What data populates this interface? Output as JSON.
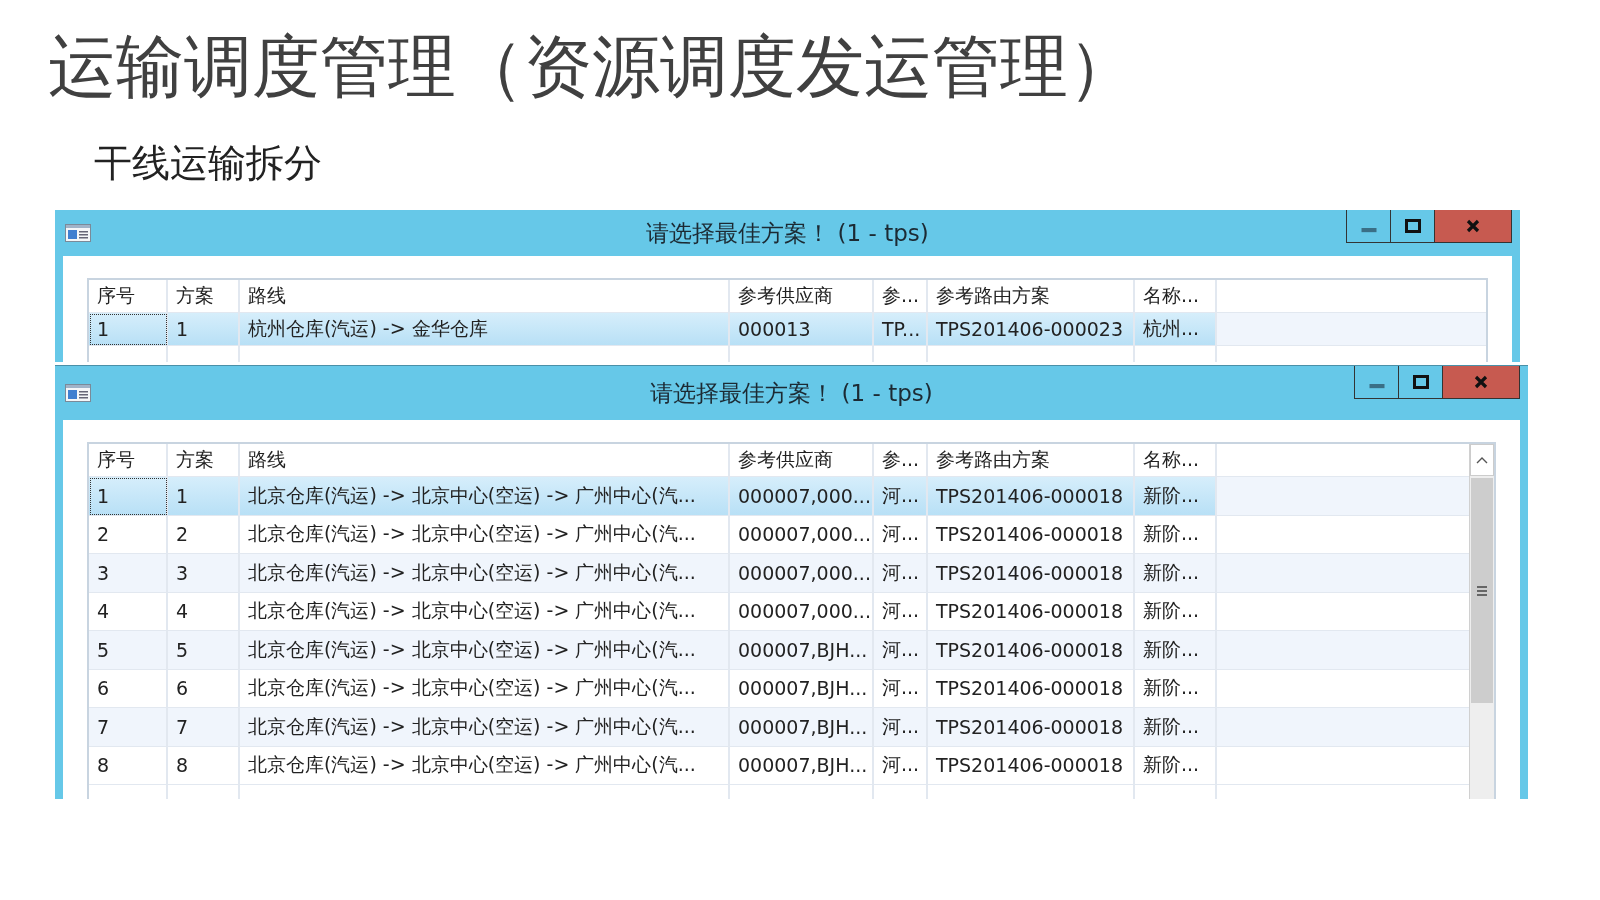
{
  "slide": {
    "title": "运输调度管理（资源调度发运管理）",
    "subtitle": "干线运输拆分"
  },
  "windows": [
    {
      "title": "请选择最佳方案！ (1 - tps)",
      "scrollbar": false,
      "columns": [
        "序号",
        "方案",
        "路线",
        "参考供应商",
        "参...",
        "参考路由方案",
        "名称..."
      ],
      "rows": [
        {
          "selected": true,
          "cells": [
            "1",
            "1",
            "杭州仓库(汽运) -> 金华仓库",
            "000013",
            "TP...",
            "TPS201406-000023",
            "杭州..."
          ]
        }
      ]
    },
    {
      "title": "请选择最佳方案！ (1 - tps)",
      "scrollbar": true,
      "columns": [
        "序号",
        "方案",
        "路线",
        "参考供应商",
        "参...",
        "参考路由方案",
        "名称..."
      ],
      "rows": [
        {
          "selected": true,
          "cells": [
            "1",
            "1",
            "北京仓库(汽运) -> 北京中心(空运) -> 广州中心(汽...",
            "000007,000...",
            "河...",
            "TPS201406-000018",
            "新阶..."
          ]
        },
        {
          "selected": false,
          "cells": [
            "2",
            "2",
            "北京仓库(汽运) -> 北京中心(空运) -> 广州中心(汽...",
            "000007,000...",
            "河...",
            "TPS201406-000018",
            "新阶..."
          ]
        },
        {
          "selected": false,
          "cells": [
            "3",
            "3",
            "北京仓库(汽运) -> 北京中心(空运) -> 广州中心(汽...",
            "000007,000...",
            "河...",
            "TPS201406-000018",
            "新阶..."
          ]
        },
        {
          "selected": false,
          "cells": [
            "4",
            "4",
            "北京仓库(汽运) -> 北京中心(空运) -> 广州中心(汽...",
            "000007,000...",
            "河...",
            "TPS201406-000018",
            "新阶..."
          ]
        },
        {
          "selected": false,
          "cells": [
            "5",
            "5",
            "北京仓库(汽运) -> 北京中心(空运) -> 广州中心(汽...",
            "000007,BJH...",
            "河...",
            "TPS201406-000018",
            "新阶..."
          ]
        },
        {
          "selected": false,
          "cells": [
            "6",
            "6",
            "北京仓库(汽运) -> 北京中心(空运) -> 广州中心(汽...",
            "000007,BJH...",
            "河...",
            "TPS201406-000018",
            "新阶..."
          ]
        },
        {
          "selected": false,
          "cells": [
            "7",
            "7",
            "北京仓库(汽运) -> 北京中心(空运) -> 广州中心(汽...",
            "000007,BJH...",
            "河...",
            "TPS201406-000018",
            "新阶..."
          ]
        },
        {
          "selected": false,
          "cells": [
            "8",
            "8",
            "北京仓库(汽运) -> 北京中心(空运) -> 广州中心(汽...",
            "000007,BJH...",
            "河...",
            "TPS201406-000018",
            "新阶..."
          ]
        }
      ]
    }
  ]
}
